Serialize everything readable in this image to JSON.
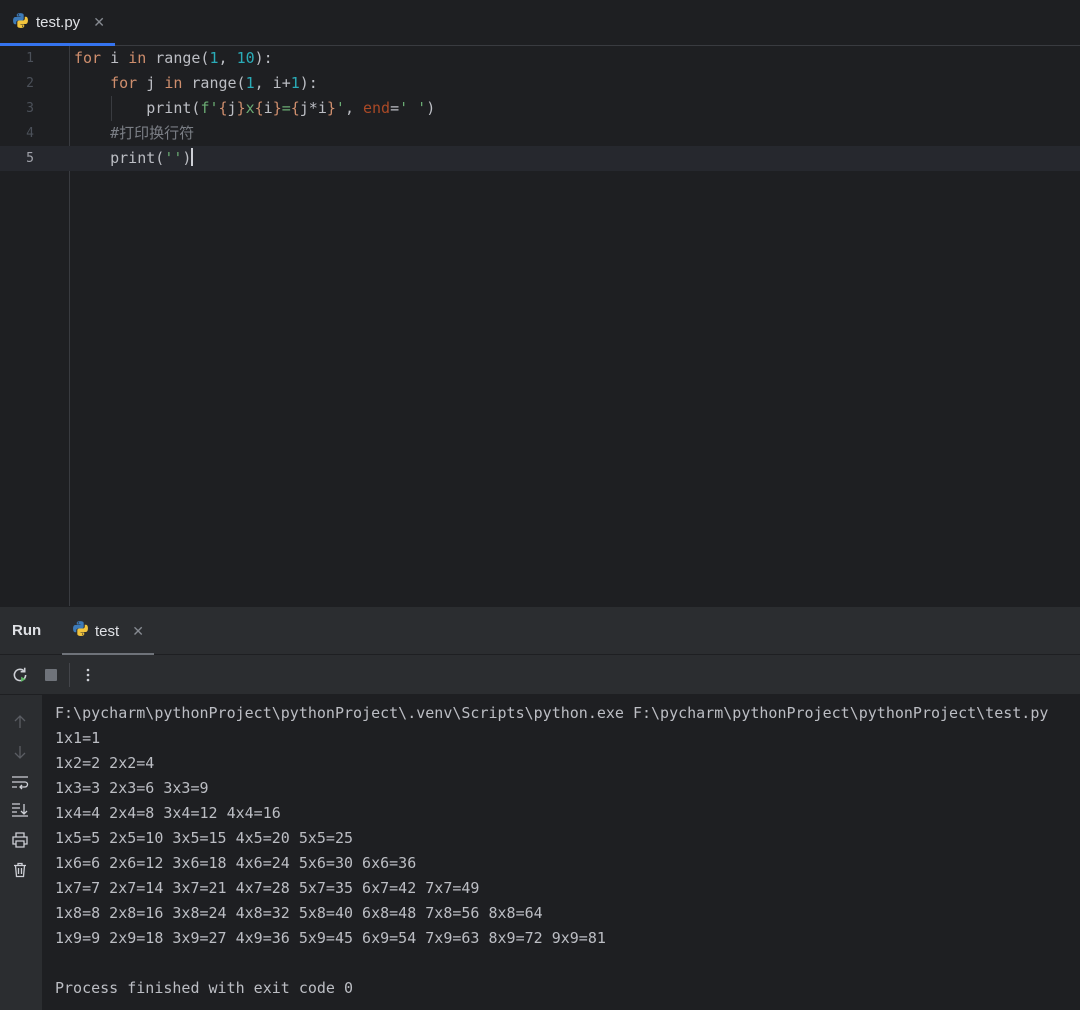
{
  "editor_tab": {
    "label": "test.py",
    "close": "✕",
    "icon": "python-file-icon"
  },
  "editor": {
    "line_numbers": [
      "1",
      "2",
      "3",
      "4",
      "5"
    ],
    "current_line": 5,
    "lines": [
      [
        {
          "t": "kw",
          "v": "for"
        },
        {
          "t": "plain",
          "v": " i "
        },
        {
          "t": "kw",
          "v": "in"
        },
        {
          "t": "plain",
          "v": " range("
        },
        {
          "t": "num",
          "v": "1"
        },
        {
          "t": "plain",
          "v": ", "
        },
        {
          "t": "num",
          "v": "10"
        },
        {
          "t": "plain",
          "v": "):"
        }
      ],
      [
        {
          "t": "plain",
          "v": "    "
        },
        {
          "t": "kw",
          "v": "for"
        },
        {
          "t": "plain",
          "v": " j "
        },
        {
          "t": "kw",
          "v": "in"
        },
        {
          "t": "plain",
          "v": " range("
        },
        {
          "t": "num",
          "v": "1"
        },
        {
          "t": "plain",
          "v": ", i+"
        },
        {
          "t": "num",
          "v": "1"
        },
        {
          "t": "plain",
          "v": "):"
        }
      ],
      [
        {
          "t": "plain",
          "v": "        print("
        },
        {
          "t": "str",
          "v": "f'"
        },
        {
          "t": "kw",
          "v": "{"
        },
        {
          "t": "plain",
          "v": "j"
        },
        {
          "t": "kw",
          "v": "}"
        },
        {
          "t": "str",
          "v": "x"
        },
        {
          "t": "kw",
          "v": "{"
        },
        {
          "t": "plain",
          "v": "i"
        },
        {
          "t": "kw",
          "v": "}"
        },
        {
          "t": "str",
          "v": "="
        },
        {
          "t": "kw",
          "v": "{"
        },
        {
          "t": "plain",
          "v": "j*i"
        },
        {
          "t": "kw",
          "v": "}"
        },
        {
          "t": "str",
          "v": "'"
        },
        {
          "t": "plain",
          "v": ", "
        },
        {
          "t": "param",
          "v": "end"
        },
        {
          "t": "plain",
          "v": "="
        },
        {
          "t": "str",
          "v": "' '"
        },
        {
          "t": "plain",
          "v": ")"
        }
      ],
      [
        {
          "t": "plain",
          "v": "    "
        },
        {
          "t": "cmt",
          "v": "#打印换行符"
        }
      ],
      [
        {
          "t": "plain",
          "v": "    print("
        },
        {
          "t": "str",
          "v": "''"
        },
        {
          "t": "plain",
          "v": ")"
        }
      ]
    ]
  },
  "run_panel": {
    "title": "Run",
    "tab_label": "test",
    "tab_close": "✕",
    "console_lines": [
      "F:\\pycharm\\pythonProject\\pythonProject\\.venv\\Scripts\\python.exe F:\\pycharm\\pythonProject\\pythonProject\\test.py",
      "1x1=1",
      "1x2=2 2x2=4",
      "1x3=3 2x3=6 3x3=9",
      "1x4=4 2x4=8 3x4=12 4x4=16",
      "1x5=5 2x5=10 3x5=15 4x5=20 5x5=25",
      "1x6=6 2x6=12 3x6=18 4x6=24 5x6=30 6x6=36",
      "1x7=7 2x7=14 3x7=21 4x7=28 5x7=35 6x7=42 7x7=49",
      "1x8=8 2x8=16 3x8=24 4x8=32 5x8=40 6x8=48 7x8=56 8x8=64",
      "1x9=9 2x9=18 3x9=27 4x9=36 5x9=45 6x9=54 7x9=63 8x9=72 9x9=81",
      "",
      "Process finished with exit code 0"
    ]
  }
}
